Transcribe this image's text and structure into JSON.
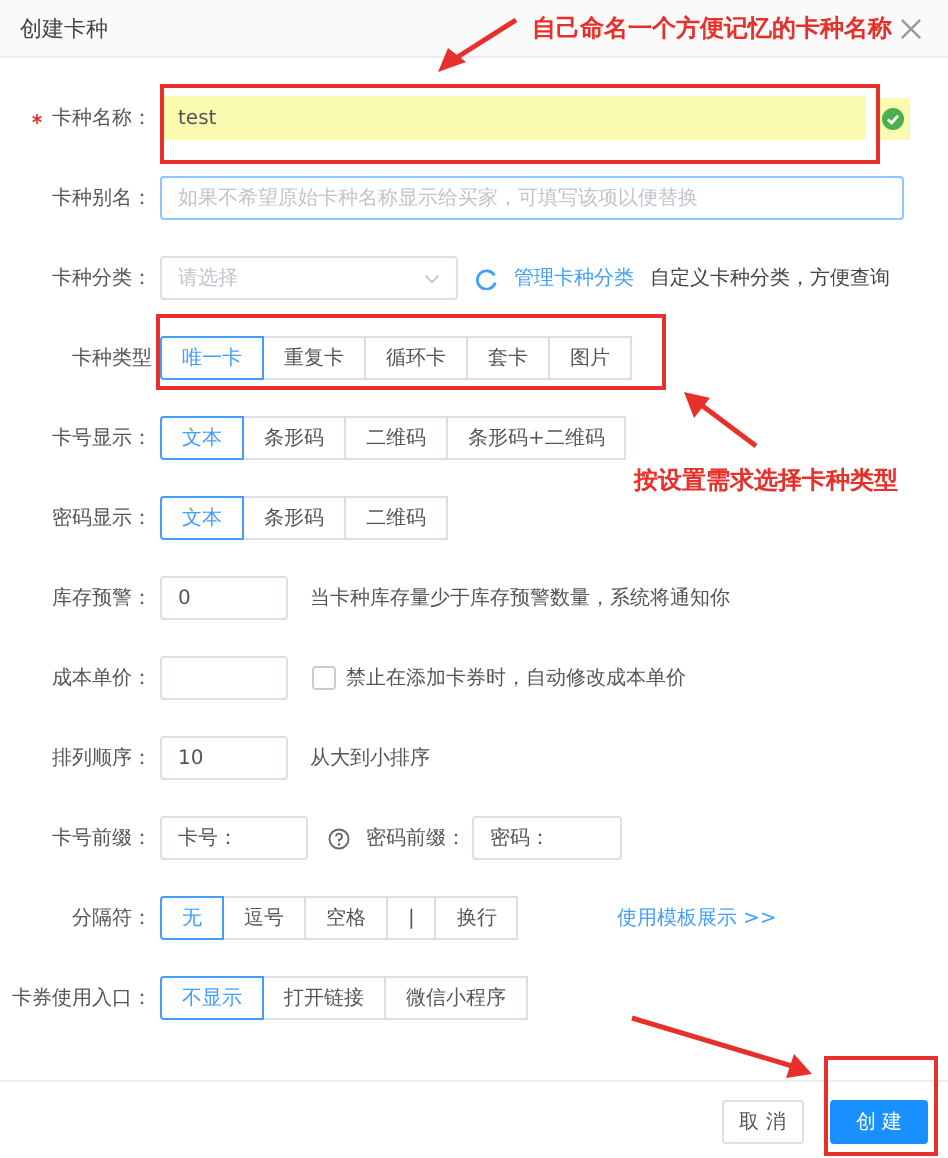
{
  "dialog": {
    "title": "创建卡种"
  },
  "rows": [
    {
      "kind": "input",
      "label": "卡种名称：",
      "required": true,
      "value": "test",
      "valid": true,
      "focused": false
    },
    {
      "kind": "input",
      "label": "卡种别名：",
      "required": false,
      "placeholder": "如果不希望原始卡种名称显示给买家，可填写该项以便替换",
      "valid": false,
      "focused": true
    },
    {
      "kind": "select",
      "label": "卡种分类：",
      "required": false,
      "placeholder": "请选择",
      "link": "管理卡种分类",
      "hint": "自定义卡种分类，方便查询"
    },
    {
      "kind": "segmented",
      "label": "卡种类型",
      "required": false,
      "options": [
        {
          "label": "唯一卡",
          "selected": true
        },
        {
          "label": "重复卡",
          "selected": false
        },
        {
          "label": "循环卡",
          "selected": false
        },
        {
          "label": "套卡",
          "selected": false
        },
        {
          "label": "图片",
          "selected": false
        }
      ]
    },
    {
      "kind": "segmented",
      "label": "卡号显示：",
      "required": false,
      "options": [
        {
          "label": "文本",
          "selected": true
        },
        {
          "label": "条形码",
          "selected": false
        },
        {
          "label": "二维码",
          "selected": false
        },
        {
          "label": "条形码+二维码",
          "selected": false
        }
      ]
    },
    {
      "kind": "segmented",
      "label": "密码显示：",
      "required": false,
      "options": [
        {
          "label": "文本",
          "selected": true
        },
        {
          "label": "条形码",
          "selected": false
        },
        {
          "label": "二维码",
          "selected": false
        }
      ]
    },
    {
      "kind": "input",
      "label": "库存预警：",
      "required": false,
      "value": "0",
      "valid": false,
      "focused": false,
      "hint": "当卡种库存量少于库存预警数量，系统将通知你"
    },
    {
      "kind": "input",
      "label": "成本单价：",
      "required": false,
      "valid": false,
      "focused": false,
      "checkbox": {
        "checked": false,
        "label": "禁止在添加卡券时，自动修改成本单价"
      }
    },
    {
      "kind": "input",
      "label": "排列顺序：",
      "required": false,
      "value": "10",
      "valid": false,
      "focused": false,
      "hint": "从大到小排序"
    },
    {
      "kind": "pair",
      "label": "卡号前缀：",
      "required": false,
      "value": "卡号：",
      "label2": "密码前缀：",
      "value2": "密码："
    },
    {
      "kind": "segmented",
      "label": "分隔符：",
      "required": false,
      "options": [
        {
          "label": "无",
          "selected": true
        },
        {
          "label": "逗号",
          "selected": false
        },
        {
          "label": "空格",
          "selected": false
        },
        {
          "label": "|",
          "selected": false
        },
        {
          "label": "换行",
          "selected": false
        }
      ],
      "link": "使用模板展示 >>"
    },
    {
      "kind": "segmented",
      "label": "卡券使用入口：",
      "required": false,
      "options": [
        {
          "label": "不显示",
          "selected": true
        },
        {
          "label": "打开链接",
          "selected": false
        },
        {
          "label": "微信小程序",
          "selected": false
        }
      ]
    }
  ],
  "buttons": [
    {
      "label": "取 消",
      "kind": "default"
    },
    {
      "label": "创 建",
      "kind": "primary"
    }
  ],
  "annotations": [
    {
      "text": "自己命名一个方便记忆的卡种名称"
    },
    {
      "text": "按设置需求选择卡种类型"
    }
  ]
}
